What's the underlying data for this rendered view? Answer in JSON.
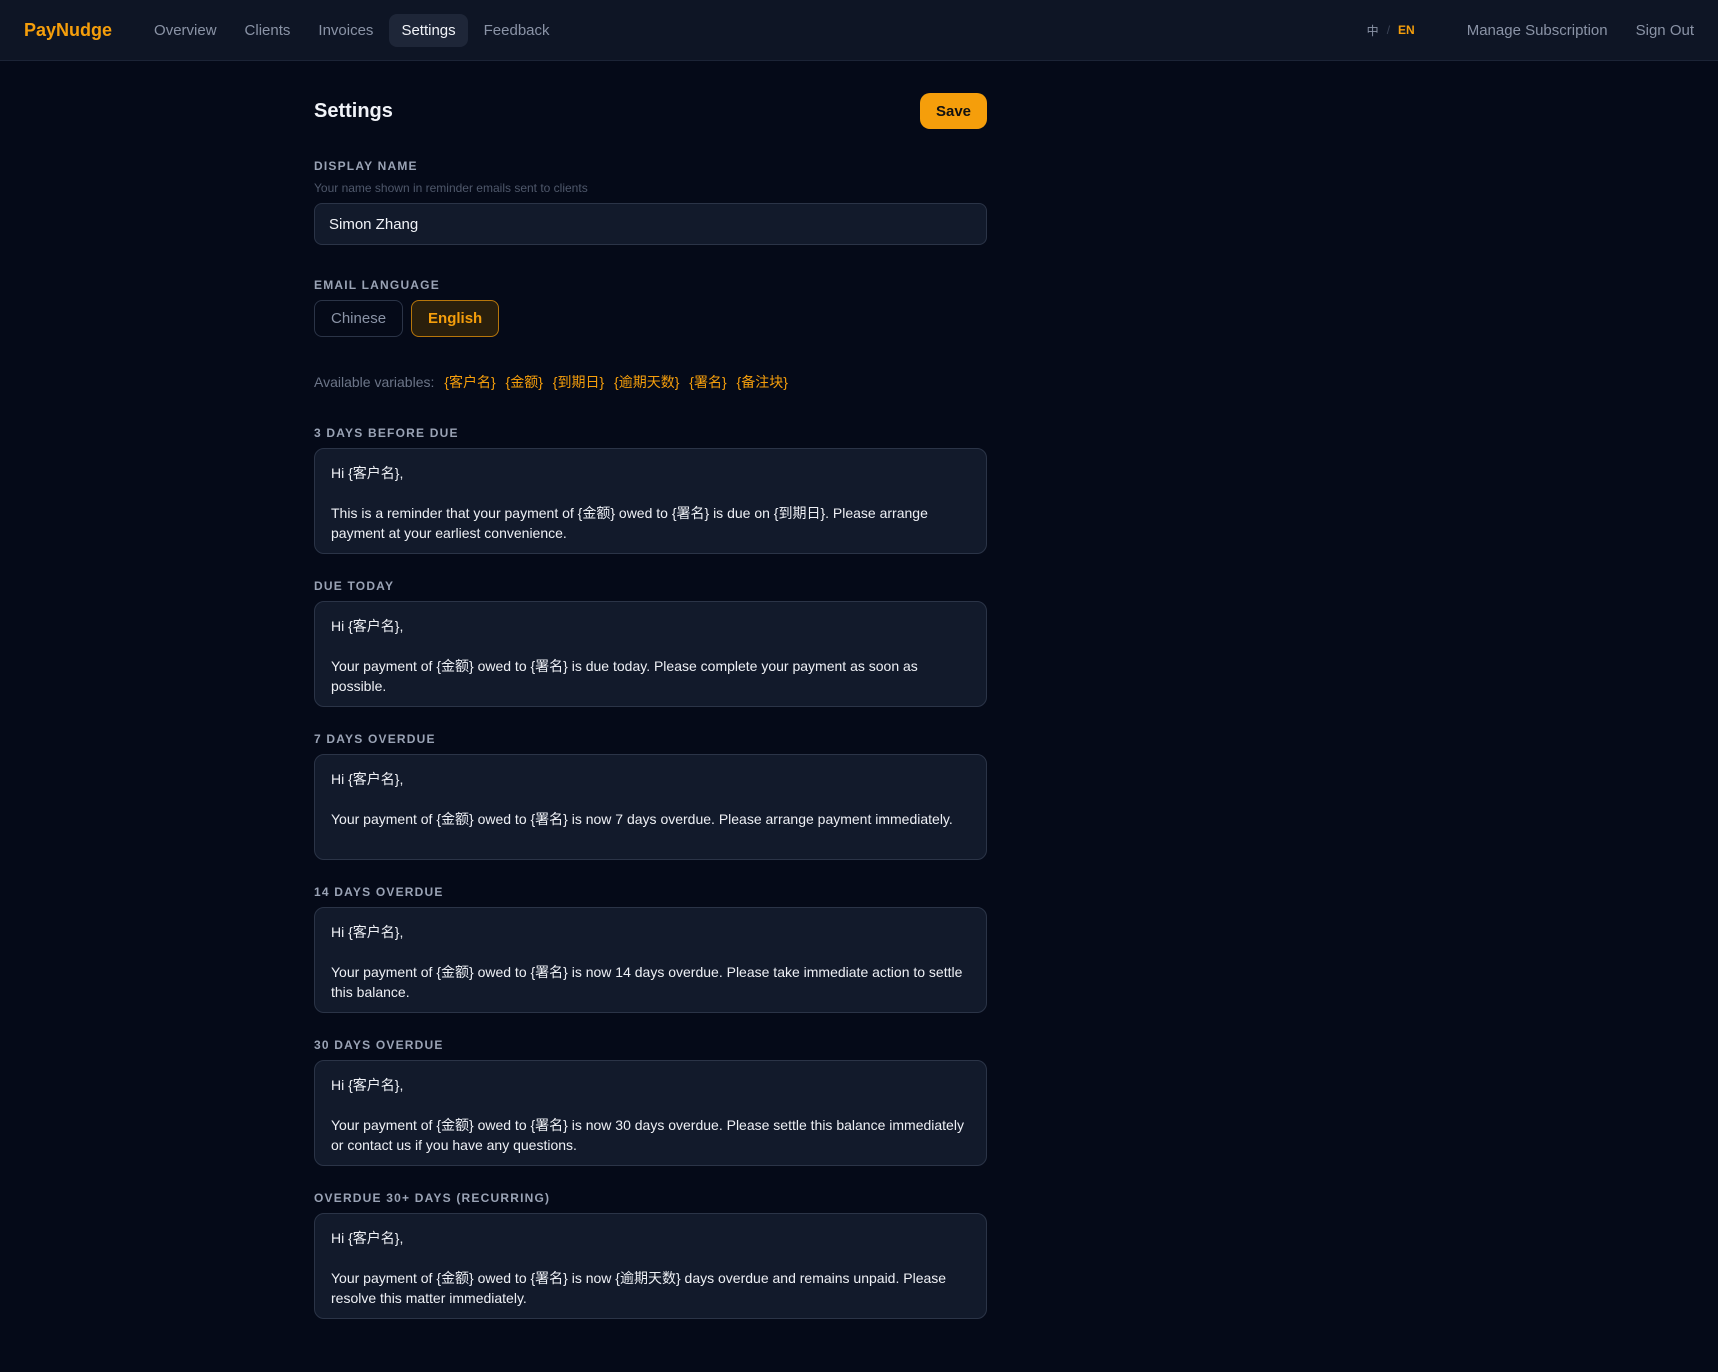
{
  "brand": "PayNudge",
  "nav": [
    "Overview",
    "Clients",
    "Invoices",
    "Settings",
    "Feedback"
  ],
  "lang_switch": {
    "zh": "中",
    "sep": "/",
    "en": "EN"
  },
  "top_links": {
    "manage": "Manage Subscription",
    "signout": "Sign Out"
  },
  "page": {
    "title": "Settings",
    "save_label": "Save"
  },
  "display_name": {
    "label": "DISPLAY NAME",
    "hint": "Your name shown in reminder emails sent to clients",
    "value": "Simon Zhang"
  },
  "email_language": {
    "label": "EMAIL LANGUAGE",
    "options": [
      "Chinese",
      "English"
    ],
    "selected": "English"
  },
  "variables": {
    "label": "Available variables:",
    "items": [
      "{客户名}",
      "{金额}",
      "{到期日}",
      "{逾期天数}",
      "{署名}",
      "{备注块}"
    ]
  },
  "templates": [
    {
      "label": "3 DAYS BEFORE DUE",
      "text": "Hi {客户名},\n\nThis is a reminder that your payment of {金额} owed to {署名} is due on {到期日}. Please arrange payment at your earliest convenience."
    },
    {
      "label": "DUE TODAY",
      "text": "Hi {客户名},\n\nYour payment of {金额} owed to {署名} is due today. Please complete your payment as soon as possible."
    },
    {
      "label": "7 DAYS OVERDUE",
      "text": "Hi {客户名},\n\nYour payment of {金额} owed to {署名} is now 7 days overdue. Please arrange payment immediately."
    },
    {
      "label": "14 DAYS OVERDUE",
      "text": "Hi {客户名},\n\nYour payment of {金额} owed to {署名} is now 14 days overdue. Please take immediate action to settle this balance."
    },
    {
      "label": "30 DAYS OVERDUE",
      "text": "Hi {客户名},\n\nYour payment of {金额} owed to {署名} is now 30 days overdue. Please settle this balance immediately or contact us if you have any questions."
    },
    {
      "label": "OVERDUE 30+ DAYS (RECURRING)",
      "text": "Hi {客户名},\n\nYour payment of {金额} owed to {署名} is now {逾期天数} days overdue and remains unpaid. Please resolve this matter immediately."
    }
  ],
  "colors": {
    "accent": "#f59e0b",
    "background": "#050a18",
    "topbar": "#0e1525",
    "field": "#121a2b"
  }
}
